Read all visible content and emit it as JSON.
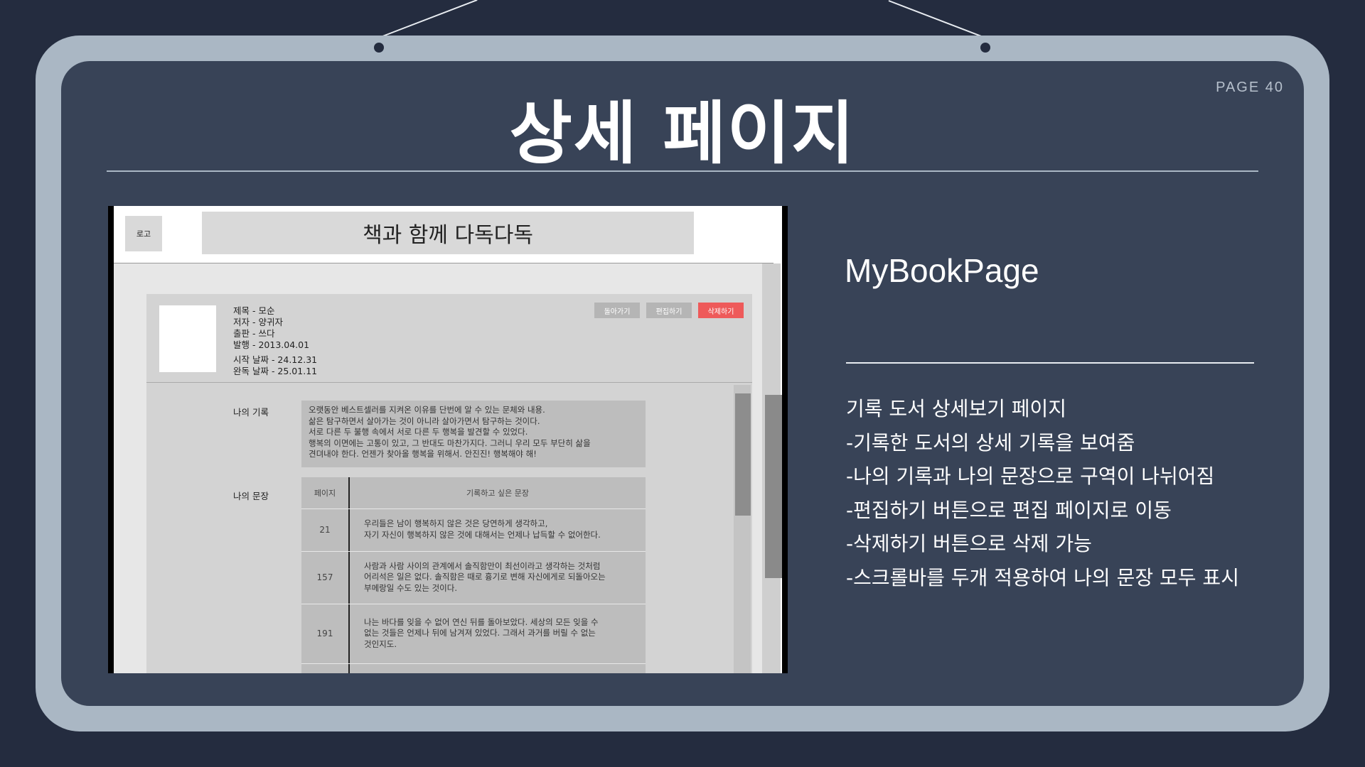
{
  "page_number": "PAGE 40",
  "title": "상세 페이지",
  "screenshot": {
    "logo_label": "로고",
    "app_title": "책과 함께 다독다독",
    "book": {
      "meta_lines": [
        "제목 - 모순",
        "저자 - 양귀자",
        "출판 - 쓰다",
        "발행 - 2013.04.01"
      ],
      "date_lines": [
        "시작 날짜 - 24.12.31",
        "완독 날짜 - 25.01.11"
      ]
    },
    "buttons": {
      "back": "돌아가기",
      "edit": "편집하기",
      "delete": "삭제하기",
      "delete_color": "#ee5a5a"
    },
    "my_record": {
      "label": "나의 기록",
      "lines": [
        "오랫동안 베스트셀러를 지켜온 이유를 단번에 알 수 있는 문체와 내용.",
        "삶은 탐구하면서 살아가는 것이 아니라 살아가면서 탐구하는 것이다.",
        "서로 다른 두 불행 속에서 서로 다른 두 행복을 발견할 수 있었다.",
        "행복의 이면에는 고통이 있고, 그 반대도 마찬가지다. 그러니 우리 모두 부단히 삶을",
        "견뎌내야 한다. 언젠가 찾아올 행복을 위해서. 안진진! 행복해야 해!"
      ]
    },
    "my_sentences": {
      "label": "나의 문장",
      "col_page": "페이지",
      "col_text": "기록하고 싶은 문장",
      "rows": [
        {
          "page": "21",
          "lines": [
            "우리들은 남이 행복하지 않은 것은 당연하게 생각하고,",
            "자기 자신이 행복하지 않은 것에 대해서는 언제나 납득할 수 없어한다."
          ]
        },
        {
          "page": "157",
          "lines": [
            "사람과 사람 사이의 관계에서 솔직함만이 최선이라고 생각하는 것처럼",
            "어리석은 일은 없다. 솔직함은 때로 흉기로 변해 자신에게로 되돌아오는",
            "부메랑일 수도 있는 것이다."
          ]
        },
        {
          "page": "191",
          "lines": [
            "나는 바다를 잊을 수 없어 연신 뒤를 돌아보았다. 세상의 모든 잊을 수",
            "없는 것들은 언제나 뒤에 남겨져 있었다. 그래서 과거를 버릴 수 없는",
            "것인지도."
          ]
        }
      ]
    }
  },
  "project_name": "MyBookPage",
  "description": [
    "기록 도서 상세보기 페이지",
    "-기록한 도서의 상세 기록을 보여줌",
    "-나의 기록과 나의 문장으로 구역이 나뉘어짐",
    "-편집하기 버튼으로 편집 페이지로 이동",
    "-삭제하기 버튼으로 삭제 가능",
    "-스크롤바를 두개 적용하여 나의 문장 모두 표시"
  ]
}
